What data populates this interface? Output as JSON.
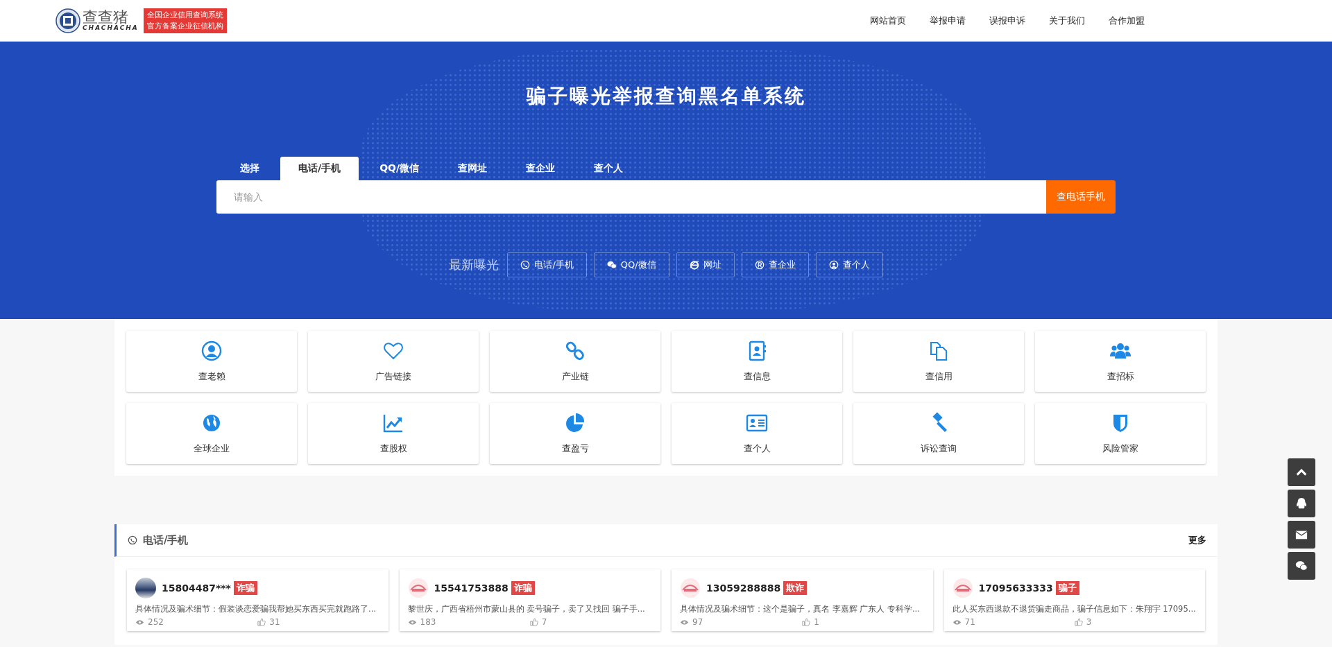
{
  "header": {
    "logo": {
      "name": "查查猪",
      "latin": "CHACHACHA",
      "tagline": [
        "全国企业信用查询系统",
        "官方备案企业征信机构"
      ]
    },
    "nav": [
      "网站首页",
      "举报申请",
      "误报申诉",
      "关于我们",
      "合作加盟"
    ]
  },
  "hero": {
    "title": "骗子曝光举报查询黑名单系统",
    "tabs": [
      {
        "label": "选择",
        "selected": false
      },
      {
        "label": "电话/手机",
        "selected": true
      },
      {
        "label": "QQ/微信",
        "selected": false
      },
      {
        "label": "查网址",
        "selected": false
      },
      {
        "label": "查企业",
        "selected": false
      },
      {
        "label": "查个人",
        "selected": false
      }
    ],
    "search": {
      "placeholder": "请输入",
      "button": "查电话手机"
    },
    "latest": {
      "label": "最新曝光",
      "buttons": [
        {
          "label": "电话/手机",
          "kind": "phone"
        },
        {
          "label": "QQ/微信",
          "kind": "wechat"
        },
        {
          "label": "网址",
          "kind": "browser"
        },
        {
          "label": "查企业",
          "kind": "registered"
        },
        {
          "label": "查个人",
          "kind": "person"
        }
      ]
    }
  },
  "services": [
    {
      "label": "查老赖",
      "kind": "person-circle"
    },
    {
      "label": "广告链接",
      "kind": "heart"
    },
    {
      "label": "产业链",
      "kind": "link"
    },
    {
      "label": "查信息",
      "kind": "contacts"
    },
    {
      "label": "查信用",
      "kind": "copy"
    },
    {
      "label": "查招标",
      "kind": "users"
    },
    {
      "label": "全球企业",
      "kind": "globe"
    },
    {
      "label": "查股权",
      "kind": "chart"
    },
    {
      "label": "查盈亏",
      "kind": "pie"
    },
    {
      "label": "查个人",
      "kind": "id-card"
    },
    {
      "label": "诉讼查询",
      "kind": "gavel"
    },
    {
      "label": "风险管家",
      "kind": "shield"
    }
  ],
  "section": {
    "title": "电话/手机",
    "more": "更多",
    "cards": [
      {
        "phone": "15804487***",
        "tag": "诈骗",
        "kind": "photo",
        "desc": "具体情况及骗术细节：假装谈恋爱骗我帮她买东西买完就跑路了...",
        "views": "252",
        "likes": "31"
      },
      {
        "phone": "15541753888",
        "tag": "诈骗",
        "kind": "logo",
        "desc": "黎世庆，广西省梧州市蒙山县的 卖号骗子，卖了又找回 骗子手...",
        "views": "183",
        "likes": "7"
      },
      {
        "phone": "13059288888",
        "tag": "欺诈",
        "kind": "logo",
        "desc": "具体情况及骗术细节：这个是骗子，真名 李嘉辉 广东人 专科学...",
        "views": "97",
        "likes": "1"
      },
      {
        "phone": "17095633333",
        "tag": "骗子",
        "kind": "logo",
        "desc": "此人买东西退款不退货骗走商品，骗子信息如下：朱翔宇 17095...",
        "views": "71",
        "likes": "3"
      }
    ]
  }
}
